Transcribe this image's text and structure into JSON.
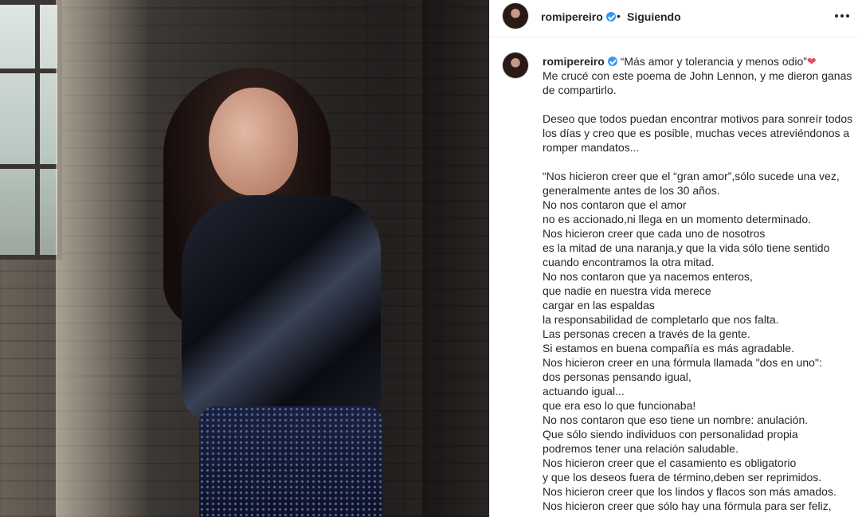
{
  "post": {
    "username": "romipereiro",
    "separator": "•",
    "follow_status": "Siguiendo",
    "more_icon": "ellipsis-icon",
    "verified_icon": "verified-badge-icon"
  },
  "caption": {
    "username": "romipereiro",
    "first_line": " “Más amor y tolerancia y menos odio”",
    "heart": "❤",
    "lines": [
      "Me crucé con este poema de John Lennon, y me dieron ganas de compartirlo.",
      "",
      "Deseo que todos puedan encontrar motivos para sonreír todos los días y creo que es posible, muchas veces atreviéndonos a romper mandatos...",
      "",
      "“Nos hicieron creer que el “gran amor”,sólo sucede una vez, generalmente antes de los 30 años.",
      "No nos contaron que el amor",
      "no es accionado,ni llega en un momento determinado.",
      "Nos hicieron creer que cada uno de nosotros",
      "es la mitad de una naranja,y que la vida sólo tiene sentido cuando encontramos la otra mitad.",
      "No nos contaron que ya nacemos enteros,",
      "que nadie en nuestra vida merece",
      "cargar en las espaldas",
      "la responsabilidad de completarlo que nos falta.",
      "Las personas crecen a través de la gente.",
      "Si estamos en buena compañía es más agradable.",
      "Nos hicieron creer en una fórmula llamada \"dos en uno\":",
      "dos personas pensando igual,",
      "actuando igual...",
      "que era eso lo que funcionaba!",
      "No nos contaron que eso tiene un nombre: anulación.",
      "Que sólo siendo individuos con personalidad propia",
      "podremos tener una relación saludable.",
      "Nos hicieron creer que el casamiento es obligatorio",
      "y que los deseos fuera de término,deben ser reprimidos.",
      "Nos hicieron creer que los lindos y flacos son más amados.",
      "Nos hicieron creer que sólo hay una fórmula para ser feliz,"
    ]
  }
}
